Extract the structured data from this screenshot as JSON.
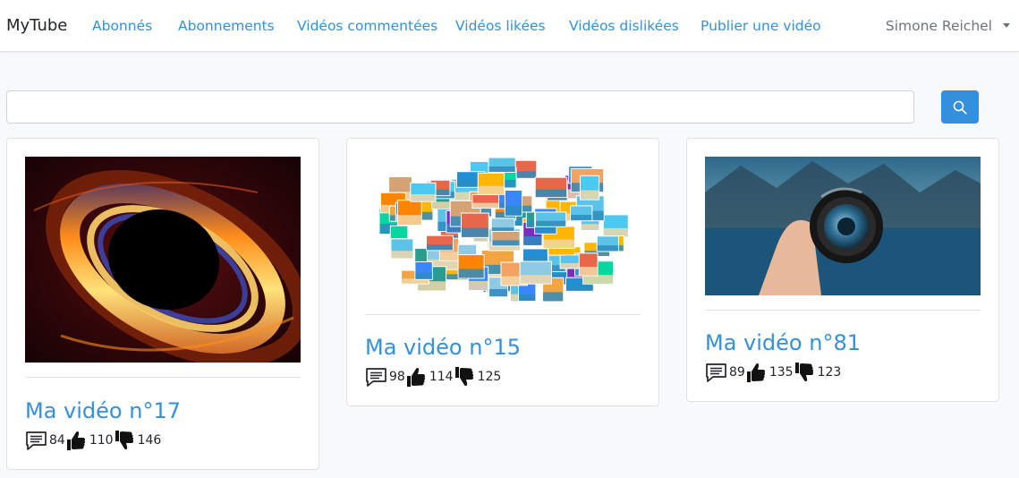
{
  "navbar": {
    "brand": "MyTube",
    "links": [
      "Abonnés",
      "Abonnements",
      "Vidéos commentées",
      "Vidéos likées",
      "Vidéos dislikées",
      "Publier une vidéo"
    ],
    "user": "Simone Reichel"
  },
  "search": {
    "value": "",
    "placeholder": ""
  },
  "colors": {
    "accent": "#3490dc",
    "background": "#f8f9fa"
  },
  "videos": [
    {
      "title": "Ma vidéo n°17",
      "comments": "84",
      "likes": "110",
      "dislikes": "146",
      "thumbnail": "black-hole"
    },
    {
      "title": "Ma vidéo n°15",
      "comments": "98",
      "likes": "114",
      "dislikes": "125",
      "thumbnail": "photo-collage"
    },
    {
      "title": "Ma vidéo n°81",
      "comments": "89",
      "likes": "135",
      "dislikes": "123",
      "thumbnail": "lens-lake"
    }
  ]
}
